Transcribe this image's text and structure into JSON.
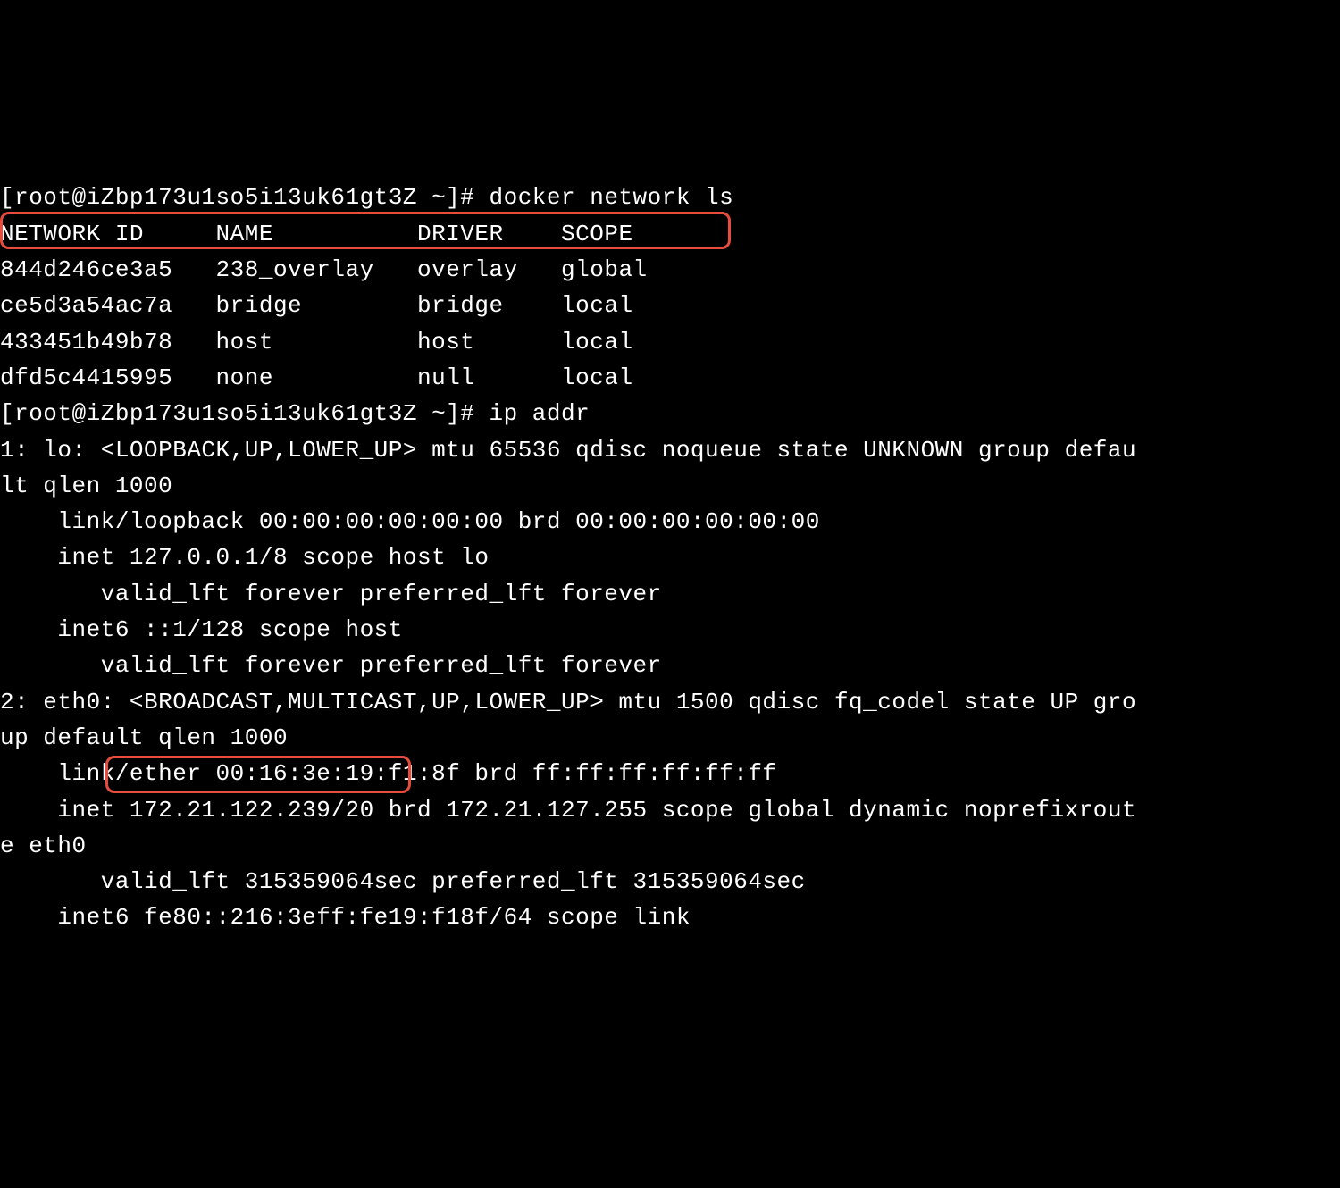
{
  "prompt1": "[root@iZbp173u1so5i13uk61gt3Z ~]# ",
  "command1": "docker network ls",
  "networks_header": {
    "id": "NETWORK ID",
    "name": "NAME",
    "driver": "DRIVER",
    "scope": "SCOPE"
  },
  "networks": [
    {
      "id": "844d246ce3a5",
      "name": "238_overlay",
      "driver": "overlay",
      "scope": "global"
    },
    {
      "id": "ce5d3a54ac7a",
      "name": "bridge",
      "driver": "bridge",
      "scope": "local"
    },
    {
      "id": "433451b49b78",
      "name": "host",
      "driver": "host",
      "scope": "local"
    },
    {
      "id": "dfd5c4415995",
      "name": "none",
      "driver": "null",
      "scope": "local"
    }
  ],
  "prompt2": "[root@iZbp173u1so5i13uk61gt3Z ~]# ",
  "command2": "ip addr",
  "ip_output": {
    "line1": "1: lo: <LOOPBACK,UP,LOWER_UP> mtu 65536 qdisc noqueue state UNKNOWN group defau",
    "line2": "lt qlen 1000",
    "line3": "    link/loopback 00:00:00:00:00:00 brd 00:00:00:00:00:00",
    "line4": "    inet 127.0.0.1/8 scope host lo",
    "line5": "       valid_lft forever preferred_lft forever",
    "line6": "    inet6 ::1/128 scope host",
    "line7": "       valid_lft forever preferred_lft forever",
    "line8": "2: eth0: <BROADCAST,MULTICAST,UP,LOWER_UP> mtu 1500 qdisc fq_codel state UP gro",
    "line9": "up default qlen 1000",
    "line10": "    link/ether 00:16:3e:19:f1:8f brd ff:ff:ff:ff:ff:ff",
    "line11": "    inet 172.21.122.239/20 brd 172.21.127.255 scope global dynamic noprefixrout",
    "line12": "e eth0",
    "line13": "       valid_lft 315359064sec preferred_lft 315359064sec",
    "line14": "    inet6 fe80::216:3eff:fe19:f18f/64 scope link"
  }
}
